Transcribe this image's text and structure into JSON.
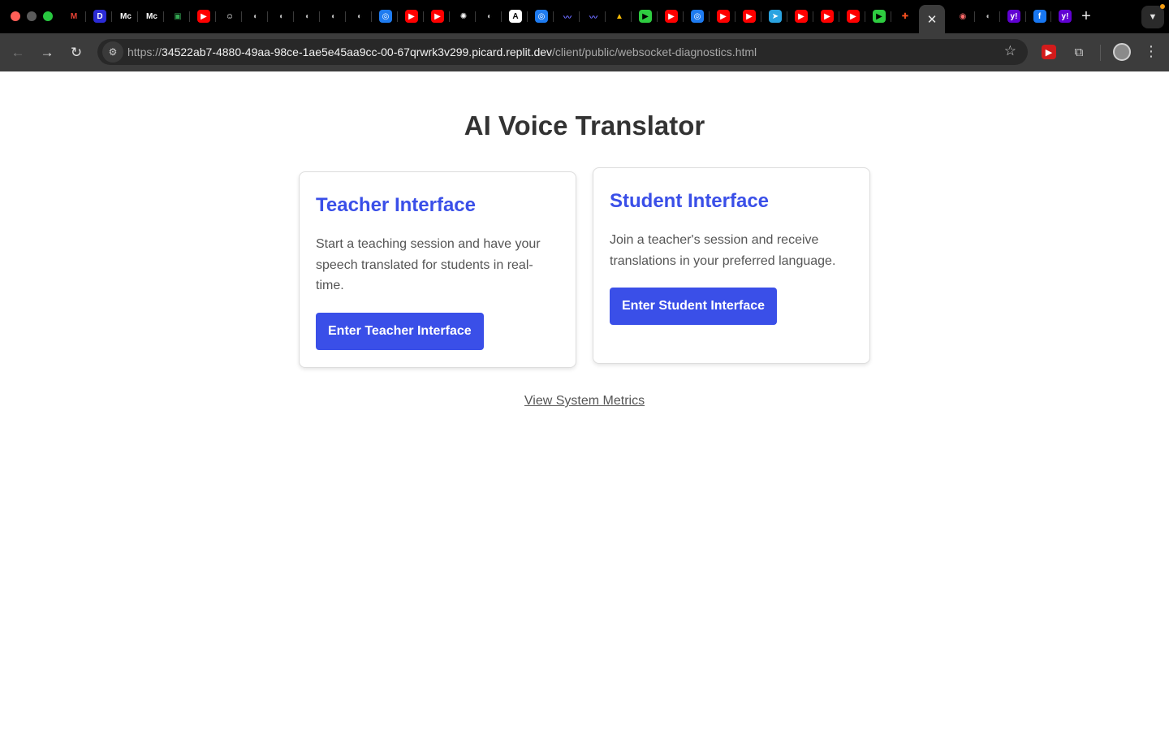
{
  "browser": {
    "url_prefix": "https://",
    "url_host": "34522ab7-4880-49aa-98ce-1ae5e45aa9cc-00-67qrwrk3v299.picard.replit.dev",
    "url_path": "/client/public/websocket-diagnostics.html",
    "active_tab_close": "✕",
    "new_tab": "+",
    "tab_icons": [
      {
        "name": "gmail-tab-icon",
        "glyph": "M",
        "color": "#ea4335",
        "bg": "transparent"
      },
      {
        "name": "d-app-tab-icon",
        "glyph": "D",
        "color": "#ffffff",
        "bg": "#2b2bd6"
      },
      {
        "name": "medium-tab-icon",
        "glyph": "Mc",
        "color": "#ffffff",
        "bg": "transparent"
      },
      {
        "name": "medium-tab-icon-2",
        "glyph": "Mc",
        "color": "#ffffff",
        "bg": "transparent"
      },
      {
        "name": "google-meet-tab-icon",
        "glyph": "▣",
        "color": "#34a853",
        "bg": "transparent"
      },
      {
        "name": "youtube-tab-icon",
        "glyph": "▶",
        "color": "#ffffff",
        "bg": "#ff0000"
      },
      {
        "name": "smiley-tab-icon",
        "glyph": "☺",
        "color": "#ffffff",
        "bg": "transparent"
      },
      {
        "name": "globe-tab-icon",
        "glyph": "◐",
        "color": "#bbbbbb",
        "bg": "transparent"
      },
      {
        "name": "globe-tab-icon-2",
        "glyph": "◐",
        "color": "#bbbbbb",
        "bg": "transparent"
      },
      {
        "name": "globe-tab-icon-3",
        "glyph": "◐",
        "color": "#bbbbbb",
        "bg": "transparent"
      },
      {
        "name": "globe-tab-icon-4",
        "glyph": "◐",
        "color": "#bbbbbb",
        "bg": "transparent"
      },
      {
        "name": "globe-tab-icon-5",
        "glyph": "◐",
        "color": "#bbbbbb",
        "bg": "transparent"
      },
      {
        "name": "spiral-tab-icon",
        "glyph": "◎",
        "color": "#ffffff",
        "bg": "#1e7bf0"
      },
      {
        "name": "youtube-tab-icon-2",
        "glyph": "▶",
        "color": "#ffffff",
        "bg": "#ff0000"
      },
      {
        "name": "youtube-tab-icon-3",
        "glyph": "▶",
        "color": "#ffffff",
        "bg": "#ff0000"
      },
      {
        "name": "openai-tab-icon",
        "glyph": "✺",
        "color": "#ffffff",
        "bg": "transparent"
      },
      {
        "name": "globe-tab-icon-6",
        "glyph": "◐",
        "color": "#bbbbbb",
        "bg": "transparent"
      },
      {
        "name": "a-app-tab-icon",
        "glyph": "A",
        "color": "#000000",
        "bg": "#ffffff"
      },
      {
        "name": "spiral-tab-icon-2",
        "glyph": "◎",
        "color": "#ffffff",
        "bg": "#1e7bf0"
      },
      {
        "name": "wave-tab-icon",
        "glyph": "〰",
        "color": "#6b6bff",
        "bg": "transparent"
      },
      {
        "name": "wave-tab-icon-2",
        "glyph": "〰",
        "color": "#6b6bff",
        "bg": "transparent"
      },
      {
        "name": "google-drive-tab-icon",
        "glyph": "▲",
        "color": "#fbbc04",
        "bg": "transparent"
      },
      {
        "name": "play-green-tab-icon",
        "glyph": "▶",
        "color": "#000000",
        "bg": "#2ecc40"
      },
      {
        "name": "youtube-tab-icon-4",
        "glyph": "▶",
        "color": "#ffffff",
        "bg": "#ff0000"
      },
      {
        "name": "spiral-tab-icon-3",
        "glyph": "◎",
        "color": "#ffffff",
        "bg": "#1e7bf0"
      },
      {
        "name": "youtube-tab-icon-5",
        "glyph": "▶",
        "color": "#ffffff",
        "bg": "#ff0000"
      },
      {
        "name": "youtube-tab-icon-6",
        "glyph": "▶",
        "color": "#ffffff",
        "bg": "#ff0000"
      },
      {
        "name": "telegram-tab-icon",
        "glyph": "➤",
        "color": "#ffffff",
        "bg": "#2aa3e0"
      },
      {
        "name": "youtube-tab-icon-7",
        "glyph": "▶",
        "color": "#ffffff",
        "bg": "#ff0000"
      },
      {
        "name": "youtube-tab-icon-8",
        "glyph": "▶",
        "color": "#ffffff",
        "bg": "#ff0000"
      },
      {
        "name": "youtube-tab-icon-9",
        "glyph": "▶",
        "color": "#ffffff",
        "bg": "#ff0000"
      },
      {
        "name": "play-green-tab-icon-2",
        "glyph": "▶",
        "color": "#000000",
        "bg": "#2ecc40"
      },
      {
        "name": "figma-tab-icon",
        "glyph": "✚",
        "color": "#f24e1e",
        "bg": "transparent"
      }
    ],
    "tab_icons_after": [
      {
        "name": "record-tab-icon",
        "glyph": "◉",
        "color": "#ff6b6b",
        "bg": "transparent"
      },
      {
        "name": "globe-tab-icon-7",
        "glyph": "◐",
        "color": "#bbbbbb",
        "bg": "transparent"
      },
      {
        "name": "yahoo-tab-icon",
        "glyph": "y!",
        "color": "#ffffff",
        "bg": "#6001d2"
      },
      {
        "name": "facebook-tab-icon",
        "glyph": "f",
        "color": "#ffffff",
        "bg": "#1877f2"
      },
      {
        "name": "yahoo-tab-icon-2",
        "glyph": "y!",
        "color": "#ffffff",
        "bg": "#6001d2"
      }
    ]
  },
  "page": {
    "title": "AI Voice Translator",
    "teacher": {
      "heading": "Teacher Interface",
      "description": "Start a teaching session and have your speech translated for students in real-time.",
      "button": "Enter Teacher Interface"
    },
    "student": {
      "heading": "Student Interface",
      "description": "Join a teacher's session and receive translations in your preferred language.",
      "button": "Enter Student Interface"
    },
    "metrics_link": "View System Metrics"
  },
  "colors": {
    "accent": "#3a4fe8",
    "title": "#333333",
    "body_text": "#555555"
  }
}
